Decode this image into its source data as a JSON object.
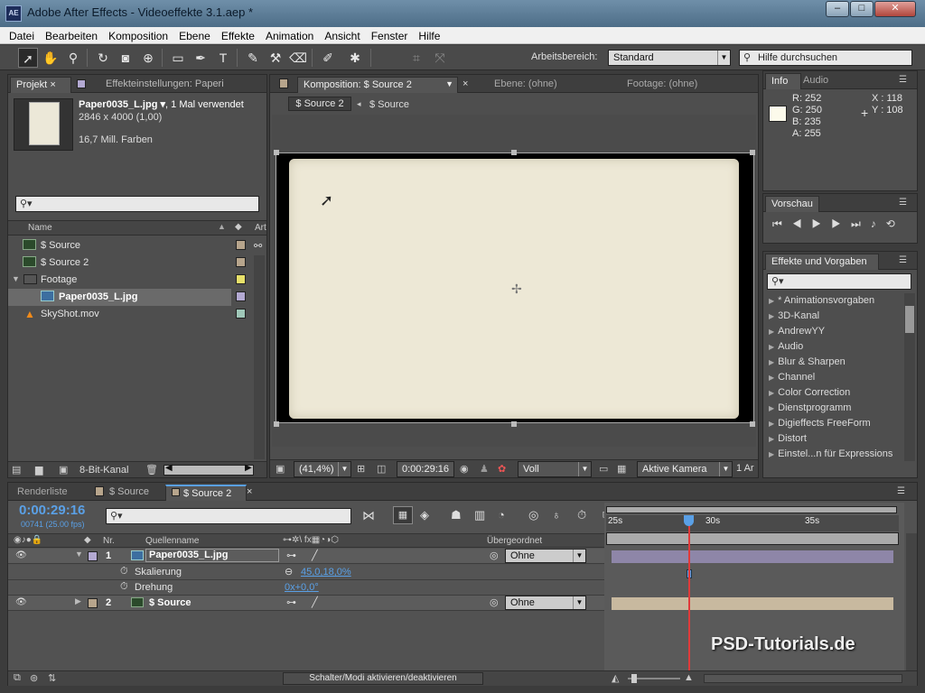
{
  "window": {
    "title": "Adobe After Effects - Videoeffekte 3.1.aep *",
    "logo": "AE",
    "min": "–",
    "max": "□",
    "close": "✕"
  },
  "menu": [
    "Datei",
    "Bearbeiten",
    "Komposition",
    "Ebene",
    "Effekte",
    "Animation",
    "Ansicht",
    "Fenster",
    "Hilfe"
  ],
  "toolbar": {
    "workspace_label": "Arbeitsbereich:",
    "workspace_value": "Standard",
    "help_placeholder": "Hilfe durchsuchen"
  },
  "project": {
    "tab_project": "Projekt",
    "tab_effects": "Effekteinstellungen: Paperi",
    "item_name": "Paper0035_L.jpg",
    "item_usage": ", 1 Mal verwendet",
    "item_size": "2846 x 4000 (1,00)",
    "item_colors": "16,7 Mill. Farben",
    "col_name": "Name",
    "col_type": "Art",
    "items": [
      {
        "label": "$ Source",
        "swatch": "#b7a58c"
      },
      {
        "label": "$ Source 2",
        "swatch": "#b7a58c"
      },
      {
        "label": "Footage",
        "swatch": "#e7e06a"
      },
      {
        "label": "Paper0035_L.jpg",
        "swatch": "#b3a9d2"
      },
      {
        "label": "SkyShot.mov",
        "swatch": "#9fc7b8"
      }
    ],
    "bitdepth": "8-Bit-Kanal"
  },
  "comp": {
    "tab_comp": "Komposition: $ Source 2",
    "tab_layer": "Ebene: (ohne)",
    "tab_footage": "Footage: (ohne)",
    "crumb_active": "$ Source 2",
    "crumb_parent": "$ Source",
    "zoom": "(41,4%)",
    "timecode": "0:00:29:16",
    "resolution": "Voll",
    "camera": "Aktive Kamera",
    "views": "1 Ar"
  },
  "info": {
    "tab_info": "Info",
    "tab_audio": "Audio",
    "r": "R:  252",
    "g": "G:  250",
    "b": "B:  235",
    "a": "A:  255",
    "x": "X : 118",
    "y": "Y : 108",
    "plus": "+",
    "swatch": "#fcfaeb"
  },
  "preview": {
    "tab": "Vorschau"
  },
  "effects": {
    "tab": "Effekte und Vorgaben",
    "items": [
      "* Animationsvorgaben",
      "3D-Kanal",
      "AndrewYY",
      "Audio",
      "Blur & Sharpen",
      "Channel",
      "Color Correction",
      "Dienstprogramm",
      "Digieffects FreeForm",
      "Distort",
      "Einstel...n für Expressions"
    ]
  },
  "timeline": {
    "tab_render": "Renderliste",
    "tab_source": "$ Source",
    "tab_source2": "$ Source 2",
    "timecode": "0:00:29:16",
    "frames": "00741 (25.00 fps)",
    "col_nr": "Nr.",
    "col_source": "Quellenname",
    "col_parent": "Übergeordnet",
    "layers": [
      {
        "nr": "1",
        "name": "Paper0035_L.jpg",
        "parent": "Ohne",
        "swatch": "#b3a9d2"
      },
      {
        "nr": "2",
        "name": "$ Source",
        "parent": "Ohne",
        "swatch": "#b7a58c"
      }
    ],
    "prop_scale": "Skalierung",
    "prop_scale_value": "45,0,18,0%",
    "prop_rotation": "Drehung",
    "prop_rotation_value": "0x+0,0°",
    "ruler": [
      "25s",
      "30s",
      "35s"
    ],
    "toggle_label": "Schalter/Modi aktivieren/deaktivieren",
    "watermark": "PSD-Tutorials.de"
  },
  "colors": {
    "accent": "#5aa0e6",
    "playhead": "#e03a3a"
  }
}
